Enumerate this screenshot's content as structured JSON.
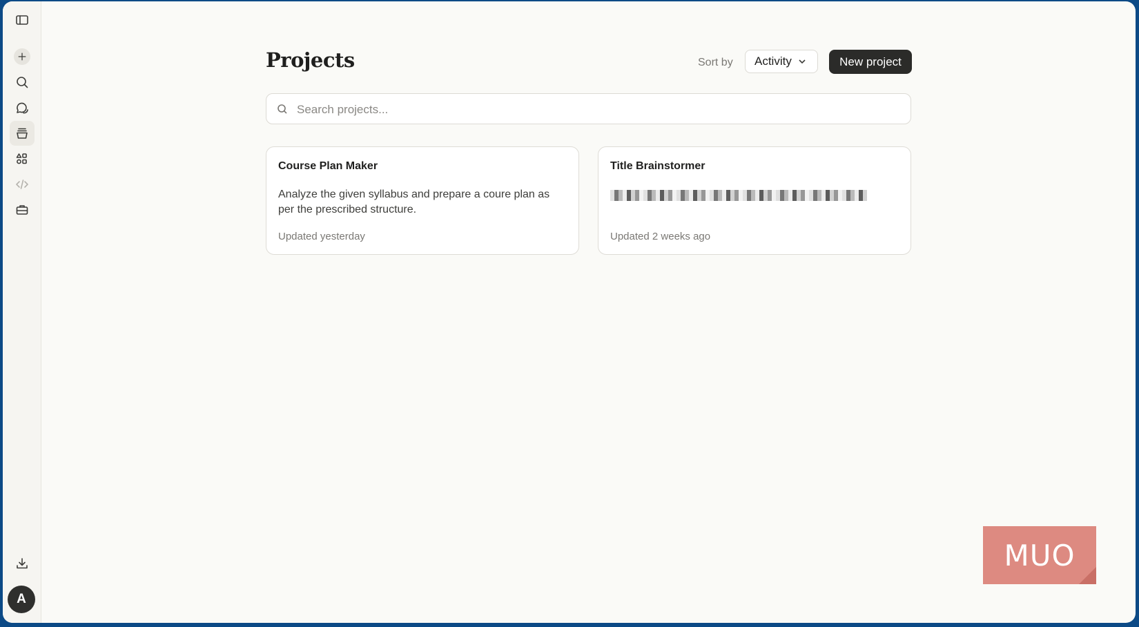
{
  "sidebar": {
    "items": [
      {
        "name": "sidebar-toggle",
        "icon": "sidebar-icon"
      },
      {
        "name": "new-chat",
        "icon": "plus-icon"
      },
      {
        "name": "search",
        "icon": "search-icon"
      },
      {
        "name": "chats",
        "icon": "chat-bubbles-icon"
      },
      {
        "name": "projects",
        "icon": "projects-icon",
        "active": true
      },
      {
        "name": "artifacts",
        "icon": "shapes-icon"
      },
      {
        "name": "code",
        "icon": "code-icon"
      },
      {
        "name": "tools",
        "icon": "briefcase-icon"
      },
      {
        "name": "download",
        "icon": "download-icon"
      }
    ],
    "avatar_initial": "A"
  },
  "header": {
    "title": "Projects",
    "sort_label": "Sort by",
    "sort_value": "Activity",
    "new_project_label": "New project"
  },
  "search": {
    "placeholder": "Search projects..."
  },
  "projects": [
    {
      "title": "Course Plan Maker",
      "description": "Analyze the given syllabus and prepare a coure plan as per the prescribed structure.",
      "updated": "Updated yesterday"
    },
    {
      "title": "Title Brainstormer",
      "description": "",
      "updated": "Updated 2 weeks ago"
    }
  ],
  "watermark": "MUO",
  "colors": {
    "background": "#fafaf7",
    "primary_button": "#2b2b29",
    "frame": "#0c4a86",
    "watermark": "#dd8a81"
  }
}
